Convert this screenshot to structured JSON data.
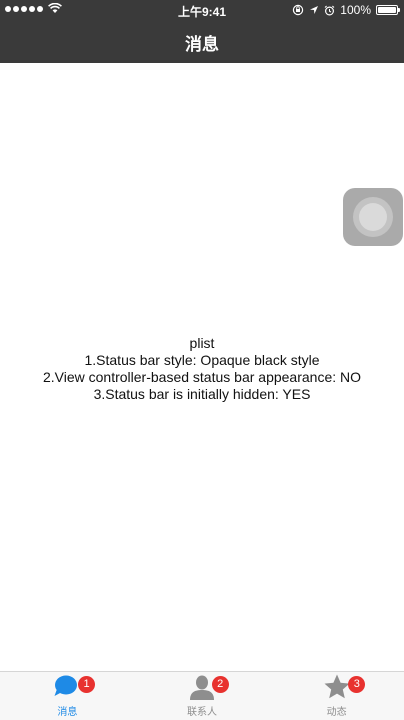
{
  "status_bar": {
    "carrier_icon": "signal-dots-icon",
    "wifi_icon": "wifi-icon",
    "time": "上午9:41",
    "battery_percent": "100%",
    "battery_level": 1.0
  },
  "nav": {
    "title": "消息"
  },
  "content": {
    "lines": [
      "plist",
      "1.Status bar style: Opaque black style",
      "2.View controller-based status bar appearance: NO",
      "3.Status bar is initially hidden: YES"
    ]
  },
  "tabs": [
    {
      "label": "消息",
      "badge": "1",
      "icon": "chat-bubble-icon",
      "active": true
    },
    {
      "label": "联系人",
      "badge": "2",
      "icon": "person-icon",
      "active": false
    },
    {
      "label": "动态",
      "badge": "3",
      "icon": "star-icon",
      "active": false
    }
  ],
  "colors": {
    "bar_background": "#3a3a3a",
    "active_tab": "#1e8ae6",
    "inactive_tab": "#8e8e8e",
    "badge": "#e8322f"
  }
}
